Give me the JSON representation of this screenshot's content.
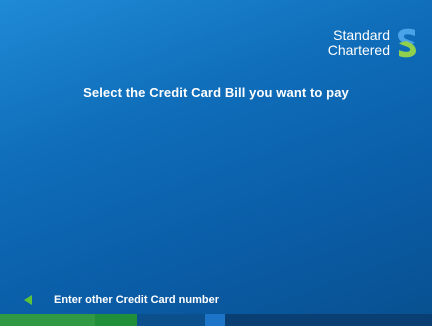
{
  "brand": {
    "line1": "Standard",
    "line2": "Chartered",
    "logo_icon": "standard-chartered-logo",
    "logo_colors": {
      "top": "#4aa3e8",
      "bottom": "#8fd14f"
    }
  },
  "prompt": "Select the Credit Card Bill you want to pay",
  "options": {
    "left_1": {
      "label": "Enter other Credit Card number",
      "icon": "left-arrow-icon"
    }
  },
  "colors": {
    "background": "#0f6db9",
    "arrow": "#5dc43a"
  },
  "bottom_bar_colors": [
    "#2f9a43",
    "#1f8f3a",
    "#0b4f8c",
    "#0a3f73",
    "#1d75c9",
    "#0b4f8c",
    "#083d6d"
  ]
}
